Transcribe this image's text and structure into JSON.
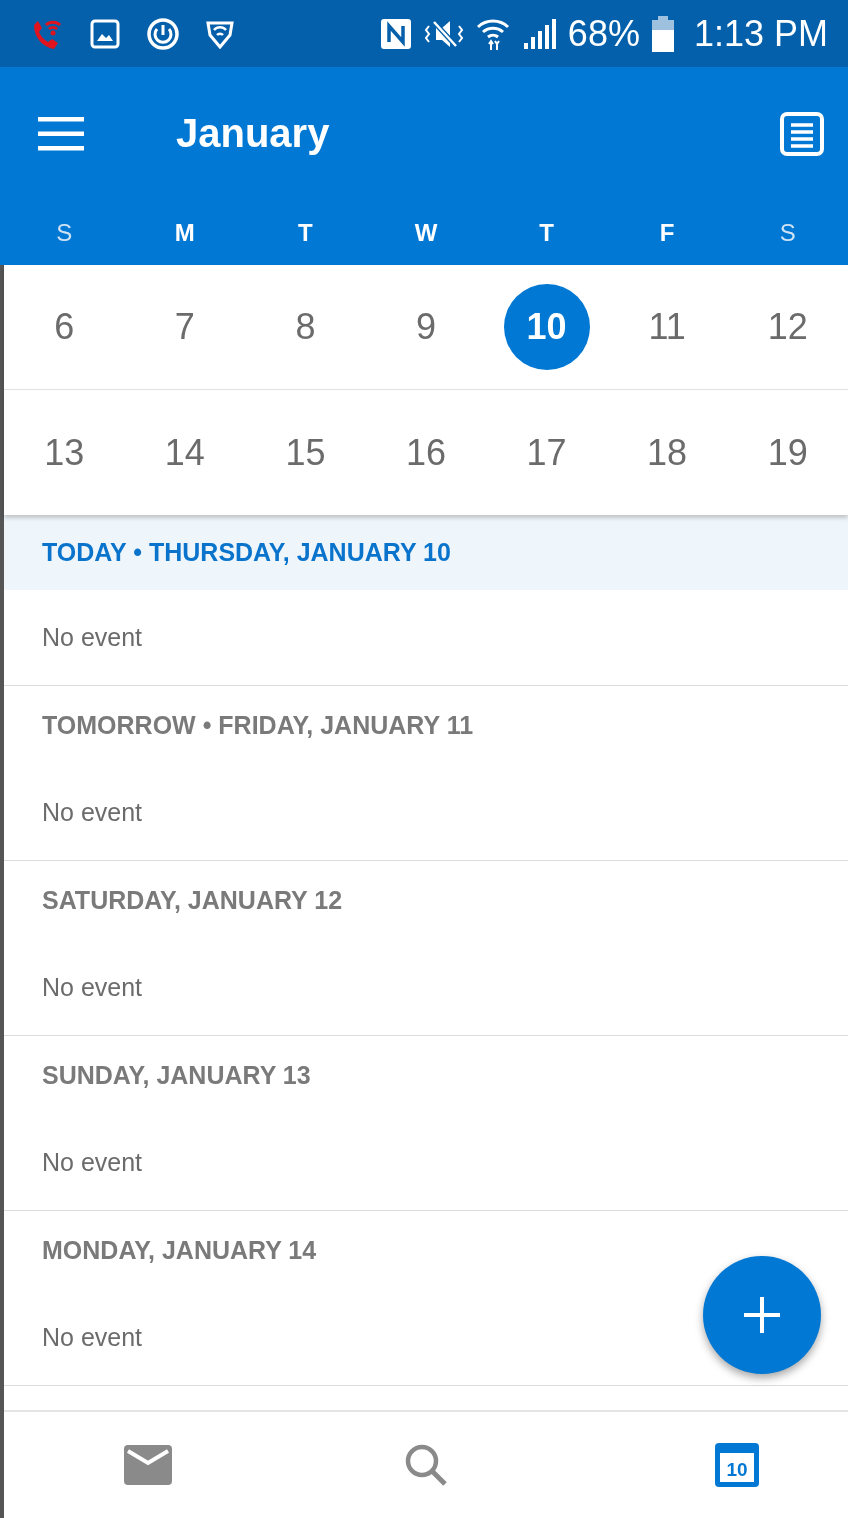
{
  "status_bar": {
    "battery": "68%",
    "time": "1:13 PM"
  },
  "header": {
    "title": "January"
  },
  "weekdays": [
    "S",
    "M",
    "T",
    "W",
    "T",
    "F",
    "S"
  ],
  "weeks": [
    [
      {
        "day": "6",
        "selected": false
      },
      {
        "day": "7",
        "selected": false
      },
      {
        "day": "8",
        "selected": false
      },
      {
        "day": "9",
        "selected": false
      },
      {
        "day": "10",
        "selected": true
      },
      {
        "day": "11",
        "selected": false
      },
      {
        "day": "12",
        "selected": false
      }
    ],
    [
      {
        "day": "13",
        "selected": false
      },
      {
        "day": "14",
        "selected": false
      },
      {
        "day": "15",
        "selected": false
      },
      {
        "day": "16",
        "selected": false
      },
      {
        "day": "17",
        "selected": false
      },
      {
        "day": "18",
        "selected": false
      },
      {
        "day": "19",
        "selected": false
      }
    ]
  ],
  "agenda": [
    {
      "heading": "TODAY • THURSDAY, JANUARY 10",
      "today": true,
      "body": "No event"
    },
    {
      "heading": "TOMORROW • FRIDAY, JANUARY 11",
      "today": false,
      "body": "No event"
    },
    {
      "heading": "SATURDAY, JANUARY 12",
      "today": false,
      "body": "No event"
    },
    {
      "heading": "SUNDAY, JANUARY 13",
      "today": false,
      "body": "No event"
    },
    {
      "heading": "MONDAY, JANUARY 14",
      "today": false,
      "body": "No event"
    }
  ],
  "bottom_nav": [
    {
      "kind": "mail",
      "selected": false
    },
    {
      "kind": "search",
      "selected": false
    },
    {
      "kind": "calendar",
      "selected": true,
      "badge": "10"
    }
  ]
}
